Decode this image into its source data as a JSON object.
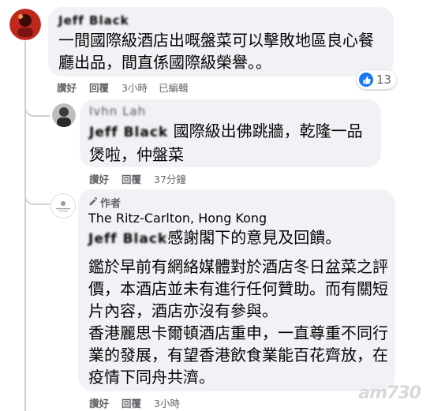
{
  "comments": [
    {
      "author": "Jeff Black",
      "text": "一間國際級酒店出嘅盤菜可以擊敗地區良心餐廳出品，間直係國際級榮譽。。",
      "actions": {
        "like": "讚好",
        "reply": "回覆",
        "time": "3小時",
        "edited": "已編輯"
      },
      "reaction_count": "13"
    },
    {
      "author": "Ivhn Lah",
      "mention": "Jeff Black",
      "text": "國際級出佛跳牆，乾隆一品煲啦，仲盤菜",
      "actions": {
        "like": "讚好",
        "reply": "回覆",
        "time": "37分鐘"
      }
    },
    {
      "author_badge": "作者",
      "author": "The Ritz-Carlton, Hong Kong",
      "mention": "Jeff Black",
      "text_first": "感謝閣下的意見及回饋。",
      "paragraph2": "鑑於早前有網絡媒體對於酒店冬日盆菜之評價，本酒店並未有進行任何贊助。而有關短片內容，酒店亦沒有參與。",
      "paragraph3": "香港麗思卡爾頓酒店重申，一直尊重不同行業的發展，有望香港飲食業能百花齊放，在疫情下同舟共濟。",
      "actions": {
        "like": "讚好",
        "reply": "回覆",
        "time": "3小時"
      }
    }
  ],
  "watermark": "am730",
  "colors": {
    "bubble": "#f0f2f5",
    "meta": "#65676b",
    "like_blue": "#1877f2"
  }
}
